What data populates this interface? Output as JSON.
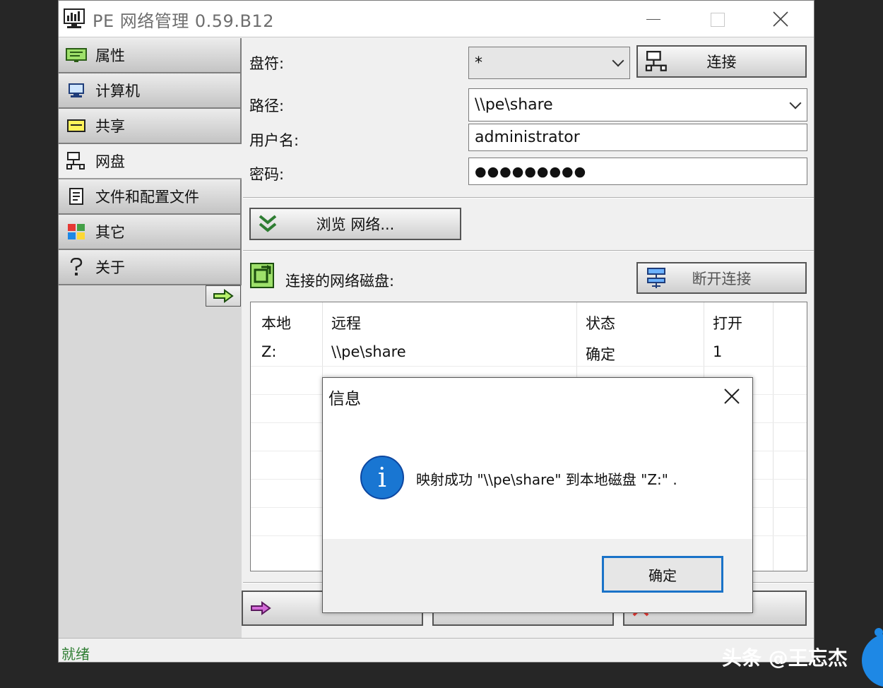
{
  "window": {
    "title": "PE 网络管理 0.59.B12"
  },
  "sidebar": {
    "items": [
      {
        "label": "属性",
        "icon": "properties-icon",
        "active": false
      },
      {
        "label": "计算机",
        "icon": "computer-icon",
        "active": false
      },
      {
        "label": "共享",
        "icon": "share-icon",
        "active": false
      },
      {
        "label": "网盘",
        "icon": "network-drive-icon",
        "active": true
      },
      {
        "label": "文件和配置文件",
        "icon": "config-file-icon",
        "active": false
      },
      {
        "label": "其它",
        "icon": "other-icon",
        "active": false
      },
      {
        "label": "关于",
        "icon": "help-icon",
        "active": false
      }
    ]
  },
  "form": {
    "drive_label": "盘符:",
    "drive_value": "*",
    "path_label": "路径:",
    "path_value": "\\\\pe\\share",
    "user_label": "用户名:",
    "user_value": "administrator",
    "password_label": "密码:",
    "password_value": "●●●●●●●●●"
  },
  "buttons": {
    "connect": "连接",
    "browse": "浏览 网络...",
    "disconnect": "断开连接"
  },
  "connected": {
    "label": "连接的网络磁盘:",
    "columns": [
      "本地",
      "远程",
      "状态",
      "打开"
    ],
    "rows": [
      {
        "local": "Z:",
        "remote": "\\\\pe\\share",
        "status": "确定",
        "open": "1"
      }
    ]
  },
  "statusbar": {
    "text": "就绪"
  },
  "dialog": {
    "title": "信息",
    "message": "映射成功 \"\\\\pe\\share\" 到本地磁盘 \"Z:\" .",
    "ok": "确定"
  },
  "watermark": "头条 @王忘杰",
  "colors": {
    "accent": "#1a73c8",
    "status_text": "#2e7d32",
    "info_icon": "#1976d2"
  }
}
